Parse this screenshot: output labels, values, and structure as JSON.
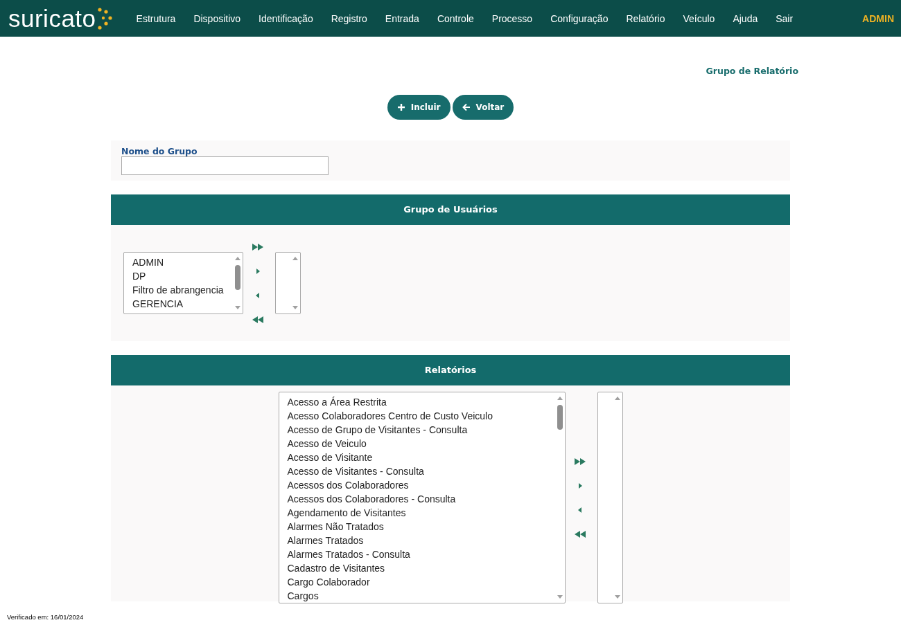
{
  "header": {
    "logo": "suricato",
    "menu": [
      "Estrutura",
      "Dispositivo",
      "Identificação",
      "Registro",
      "Entrada",
      "Controle",
      "Processo",
      "Configuração",
      "Relatório",
      "Veículo",
      "Ajuda",
      "Sair"
    ],
    "user": "ADMIN"
  },
  "page_title": "Grupo de Relatório",
  "buttons": [
    {
      "label": "Incluir",
      "kind": "add"
    },
    {
      "label": "Voltar",
      "kind": "back"
    }
  ],
  "form": {
    "label": "Nome do Grupo"
  },
  "sections": [
    {
      "title": "Grupo de Usuários",
      "available": [
        "ADMIN",
        "DP",
        "Filtro de abrangencia",
        "GERENCIA"
      ]
    },
    {
      "title": "Relatórios",
      "available": [
        "Acesso a Área Restrita",
        "Acesso Colaboradores Centro de Custo Veiculo",
        "Acesso de Grupo de Visitantes - Consulta",
        "Acesso de Veiculo",
        "Acesso de Visitante",
        "Acesso de Visitantes - Consulta",
        "Acessos dos Colaboradores",
        "Acessos dos Colaboradores - Consulta",
        "Agendamento de Visitantes",
        "Alarmes Não Tratados",
        "Alarmes Tratados",
        "Alarmes Tratados - Consulta",
        "Cadastro de Visitantes",
        "Cargo Colaborador",
        "Cargos"
      ]
    }
  ],
  "footer": "Verificado em: 16/01/2024"
}
